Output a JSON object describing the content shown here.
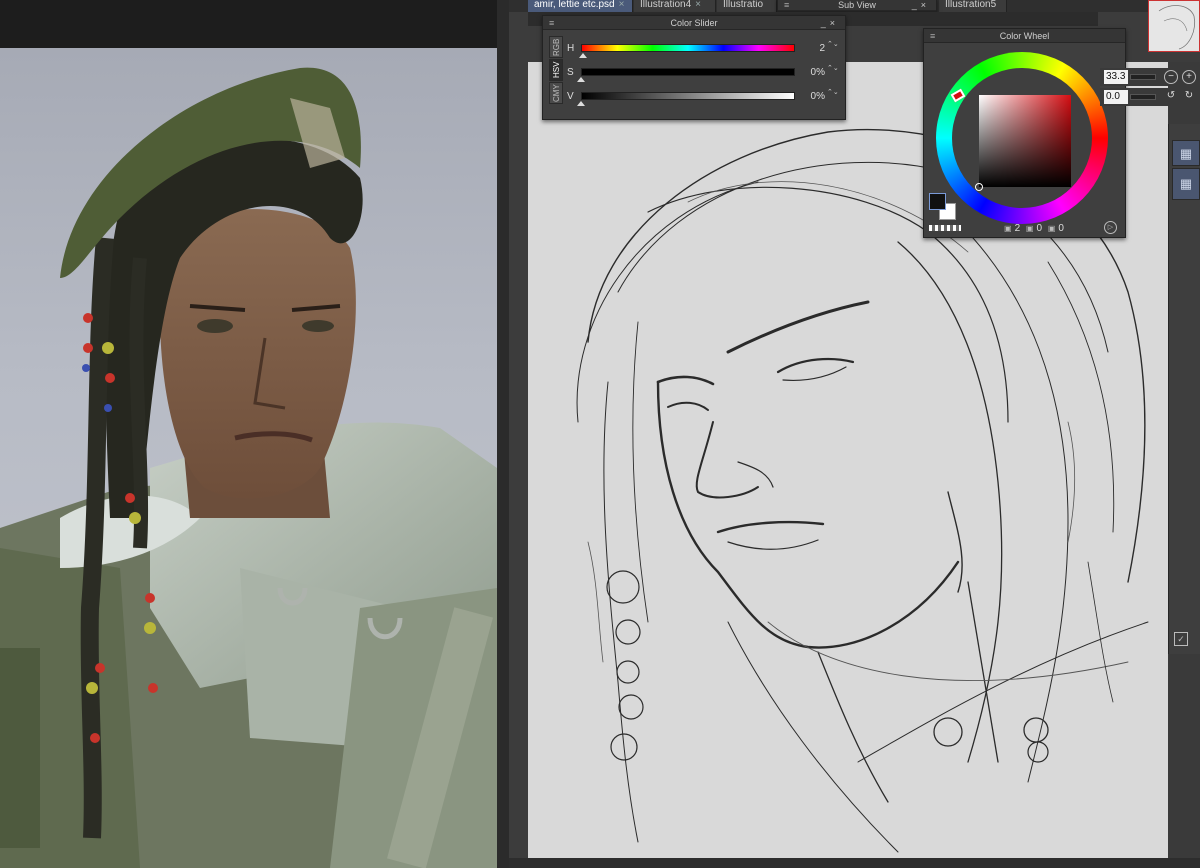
{
  "tabs": [
    {
      "label": "amir, lettie etc.psd",
      "active": true
    },
    {
      "label": "Illustration4",
      "active": false
    },
    {
      "label": "Illustratio",
      "active": false
    },
    {
      "label": "Illustration5",
      "active": false
    }
  ],
  "tab_close": "×",
  "sub_view": {
    "title": "Sub View"
  },
  "color_slider": {
    "title": "Color Slider",
    "modes": [
      "RGB",
      "HSV",
      "CMY"
    ],
    "active_mode": "HSV",
    "rows": [
      {
        "label": "H",
        "value": "2",
        "level": 0.01
      },
      {
        "label": "S",
        "value": "0%",
        "level": 0.0
      },
      {
        "label": "V",
        "value": "0%",
        "level": 0.0
      }
    ]
  },
  "color_wheel": {
    "title": "Color Wheel",
    "readout": {
      "h": "2",
      "s": "0",
      "v": "0"
    }
  },
  "navigator": {
    "zoom": "33.3",
    "rotation": "0.0"
  },
  "colors": {
    "accent_blue": "#4a5a7a",
    "main_color": "#111111",
    "sub_color": "#ffffff",
    "hue_red": "#d40d12",
    "canvas": "#d9d9d9"
  },
  "icons": {
    "panel_menu": "≡",
    "minimize": "_",
    "close": "×",
    "spin": "⌃⌄",
    "zoom_out": "−",
    "zoom_in": "+",
    "rotate_left": "↺",
    "rotate_right": "↻",
    "play": "▷",
    "layer": "▦"
  }
}
